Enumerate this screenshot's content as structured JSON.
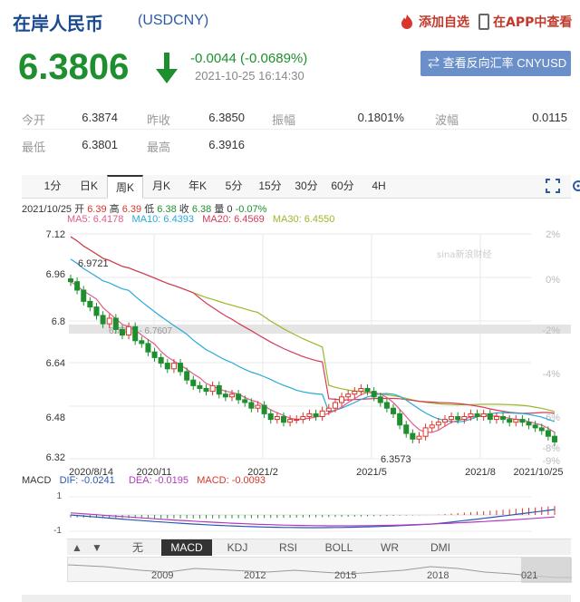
{
  "header": {
    "title": "在岸人民币",
    "code": "(USDCNY)",
    "add_fav": "添加自选",
    "app_view": "在APP中查看"
  },
  "quote": {
    "price": "6.3806",
    "change": "-0.0044 (-0.0689%)",
    "time": "2021-10-25 16:14:30",
    "reverse_btn": "查看反向汇率 CNYUSD",
    "color_down": "#1e8f2e"
  },
  "stats": {
    "open_label": "今开",
    "open": "6.3874",
    "prev_label": "昨收",
    "prev": "6.3850",
    "amp_label": "振幅",
    "amp": "0.1801%",
    "wave_label": "波幅",
    "wave": "0.0115",
    "low_label": "最低",
    "low": "6.3801",
    "high_label": "最高",
    "high": "6.3916"
  },
  "tabs": [
    "1分",
    "日K",
    "周K",
    "月K",
    "年K",
    "5分",
    "15分",
    "30分",
    "60分",
    "4H"
  ],
  "active_tab": "周K",
  "info": {
    "date": "2021/10/25",
    "o_lbl": "开",
    "o": "6.39",
    "h_lbl": "高",
    "h": "6.39",
    "l_lbl": "低",
    "l": "6.38",
    "c_lbl": "收",
    "c": "6.38",
    "chg_lbl": "量",
    "vol": "0",
    "pct": "-0.07%",
    "ma5": "MA5: 6.4178",
    "ma10": "MA10: 6.4393",
    "ma20": "MA20: 6.4569",
    "ma30": "MA30: 6.4550"
  },
  "watermark": "sina新浪财经",
  "chart_data": {
    "type": "candlestick",
    "y_left_ticks": [
      "7.12",
      "6.96",
      "6.8",
      "6.64",
      "6.48",
      "6.32"
    ],
    "y_right_ticks": [
      "2%",
      "0%",
      "-2%",
      "-4%",
      "-6%",
      "-8%",
      "-9%"
    ],
    "x_ticks": [
      "2020/8/14",
      "2020/11",
      "2021/2",
      "2021/5",
      "2021/8",
      "2021/10/25"
    ],
    "ylim": [
      6.32,
      7.12
    ],
    "annotations": [
      "6.9721",
      "6.3573",
      "6.7865 - 6.7607"
    ],
    "ma_colors": {
      "ma5": "#e05c8a",
      "ma10": "#29a9d8",
      "ma20": "#d63a5a",
      "ma30": "#9ab82a"
    }
  },
  "macd": {
    "label": "MACD",
    "dif": "DIF: -0.0241",
    "dea": "DEA: -0.0195",
    "macd": "MACD: -0.0093",
    "y_top": "1",
    "y_bot": "-1"
  },
  "indicators": [
    "无",
    "MACD",
    "KDJ",
    "RSI",
    "BOLL",
    "WR",
    "DMI"
  ],
  "active_indicator": "MACD",
  "navigator": {
    "years": [
      "2009",
      "2012",
      "2015",
      "2018",
      "021"
    ]
  }
}
